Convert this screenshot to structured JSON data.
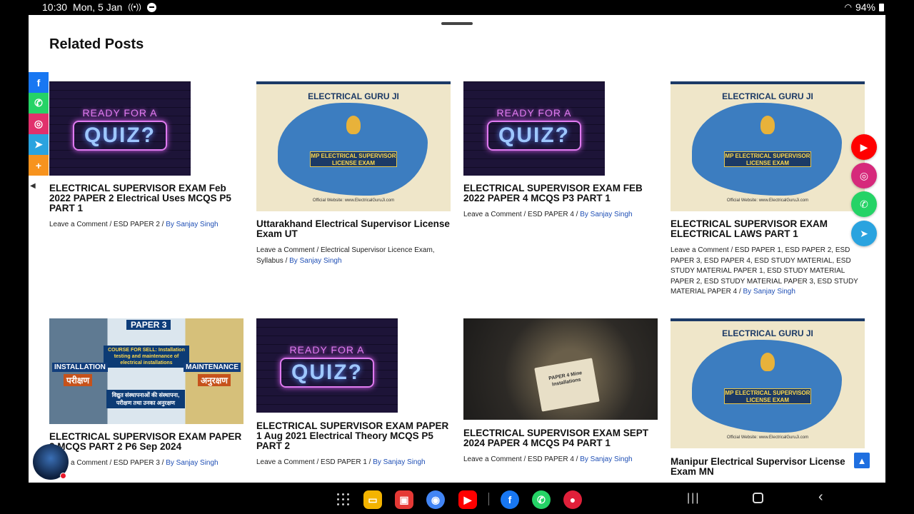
{
  "status_bar": {
    "time": "10:30",
    "date": "Mon, 5 Jan",
    "battery": "94%"
  },
  "page": {
    "heading": "Related Posts"
  },
  "posts": [
    {
      "title": "ELECTRICAL SUPERVISOR EXAM Feb 2022 PAPER 2 Electrical Uses MCQS P5 PART 1",
      "meta": "Leave a Comment / ESD PAPER 2 / ",
      "author": "By Sanjay Singh",
      "thumb": {
        "line1": "READY FOR A",
        "line2": "QUIZ?"
      }
    },
    {
      "title": "Uttarakhand Electrical Supervisor License Exam UT",
      "meta": "Leave a Comment / Electrical Supervisor Licence Exam, Syllabus / ",
      "author": "By Sanjay Singh",
      "thumb": {
        "brand": "ELECTRICAL GURU JI",
        "banner": "MP ELECTRICAL SUPERVISOR LICENSE EXAM",
        "website": "Official Website: www.ElectricalGuruJi.com"
      }
    },
    {
      "title": "ELECTRICAL SUPERVISOR EXAM FEB 2022 PAPER 4 MCQS P3 PART 1",
      "meta": "Leave a Comment / ESD PAPER 4 / ",
      "author": "By Sanjay Singh",
      "thumb": {
        "line1": "READY FOR A",
        "line2": "QUIZ?"
      }
    },
    {
      "title": "ELECTRICAL SUPERVISOR EXAM ELECTRICAL LAWS PART 1",
      "meta": "Leave a Comment / ESD PAPER 1, ESD PAPER 2, ESD PAPER 3, ESD PAPER 4, ESD STUDY MATERIAL, ESD STUDY MATERIAL PAPER 1, ESD STUDY MATERIAL PAPER 2, ESD STUDY MATERIAL PAPER 3, ESD STUDY MATERIAL PAPER 4 / ",
      "author": "By Sanjay Singh",
      "thumb": {
        "brand": "ELECTRICAL GURU JI",
        "banner": "MP ELECTRICAL SUPERVISOR LICENSE EXAM",
        "website": "Official Website: www.ElectricalGuruJi.com"
      }
    },
    {
      "title": "ELECTRICAL SUPERVISOR EXAM PAPER 3 MCQS PART 2 P6 Sep 2024",
      "meta": "Leave a Comment / ESD PAPER 3 / ",
      "author": "By Sanjay Singh",
      "thumb": {
        "tag": "PAPER 3",
        "sell": "COURSE FOR SELL: Installation testing and maintenance of electrical installations",
        "left": "INSTALLATION",
        "right": "MAINTENANCE",
        "hindi_left": "परीक्षण",
        "hindi_right": "अनुरक्षण",
        "hindi_center": "विद्युत संस्थापनाओं की संस्थापना, परीक्षण तथा उनका अनुरक्षण"
      }
    },
    {
      "title": "ELECTRICAL SUPERVISOR EXAM PAPER 1 Aug 2021 Electrical Theory MCQS P5 PART 2",
      "meta": "Leave a Comment / ESD PAPER 1 / ",
      "author": "By Sanjay Singh",
      "thumb": {
        "line1": "READY FOR A",
        "line2": "QUIZ?"
      }
    },
    {
      "title": "ELECTRICAL SUPERVISOR EXAM SEPT 2024 PAPER 4 MCQS P4 PART 1",
      "meta": "Leave a Comment / ESD PAPER 4 / ",
      "author": "By Sanjay Singh",
      "thumb": {
        "book": "PAPER 4 Mine Installations"
      }
    },
    {
      "title": "Manipur Electrical Supervisor License Exam MN",
      "meta": "",
      "author": "",
      "thumb": {
        "brand": "ELECTRICAL GURU JI",
        "banner": "MP ELECTRICAL SUPERVISOR LICENSE EXAM",
        "website": "Official Website: www.ElectricalGuruJi.com"
      }
    }
  ],
  "share_buttons": [
    {
      "name": "facebook",
      "glyph": "f",
      "color": "#1877f2"
    },
    {
      "name": "whatsapp",
      "glyph": "✆",
      "color": "#25d366"
    },
    {
      "name": "instagram",
      "glyph": "◎",
      "color": "#e1306c"
    },
    {
      "name": "telegram",
      "glyph": "➤",
      "color": "#2aa3df"
    },
    {
      "name": "more",
      "glyph": "+",
      "color": "#f7931e"
    }
  ],
  "social_float": [
    {
      "name": "youtube",
      "glyph": "▶",
      "color": "#ff0000"
    },
    {
      "name": "instagram",
      "glyph": "◎",
      "color": "#d6297b"
    },
    {
      "name": "whatsapp",
      "glyph": "✆",
      "color": "#25d366"
    },
    {
      "name": "telegram",
      "glyph": "➤",
      "color": "#2aa3df"
    }
  ],
  "dock": [
    {
      "name": "files",
      "color": "#f4b400",
      "glyph": "▭"
    },
    {
      "name": "notes",
      "color": "#e53935",
      "glyph": "▣"
    },
    {
      "name": "chrome",
      "color": "#4285f4",
      "glyph": "◉"
    },
    {
      "name": "youtube",
      "color": "#ff0000",
      "glyph": "▶"
    },
    {
      "name": "facebook",
      "color": "#1877f2",
      "glyph": "f"
    },
    {
      "name": "whatsapp",
      "color": "#25d366",
      "glyph": "✆"
    },
    {
      "name": "screen-recorder",
      "color": "#e0203a",
      "glyph": "●"
    }
  ]
}
